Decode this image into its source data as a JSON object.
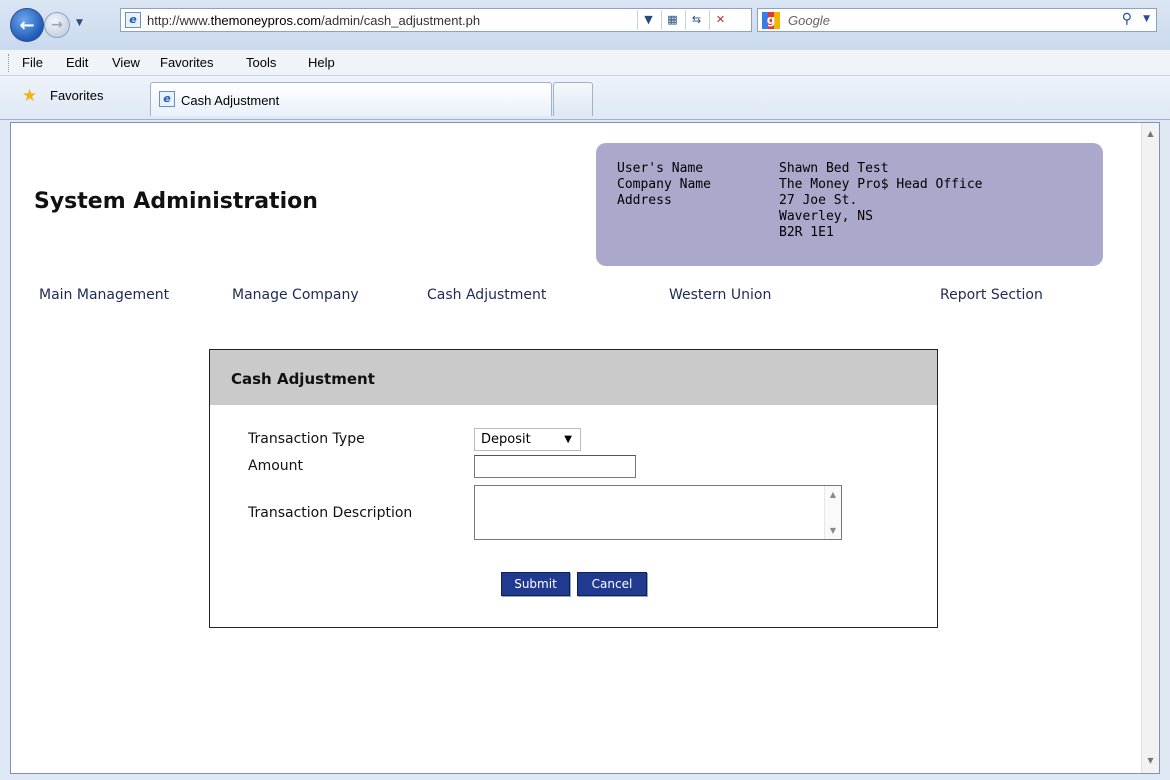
{
  "browser": {
    "url_prefix": "http://www.",
    "url_domain": "themoneypros.com",
    "url_path": "/admin/cash_adjustment.ph",
    "search_placeholder": "Google",
    "menu": [
      "File",
      "Edit",
      "View",
      "Favorites",
      "Tools",
      "Help"
    ],
    "favorites_label": "Favorites",
    "tab_label": "Cash Adjustment"
  },
  "page": {
    "title": "System Administration"
  },
  "user_info": {
    "labels": [
      "User's Name",
      "Company Name",
      "Address"
    ],
    "name": "Shawn Bed Test",
    "company": "The Money Pro$ Head Office",
    "address": [
      "27 Joe St.",
      "Waverley, NS",
      "B2R 1E1"
    ]
  },
  "nav": [
    "Main Management",
    "Manage Company",
    "Cash Adjustment",
    "Western Union",
    "Report Section"
  ],
  "form": {
    "heading": "Cash Adjustment",
    "transaction_type_label": "Transaction Type",
    "transaction_type_value": "Deposit",
    "amount_label": "Amount",
    "amount_value": "",
    "description_label": "Transaction Description",
    "description_value": "",
    "submit_label": "Submit",
    "cancel_label": "Cancel"
  }
}
